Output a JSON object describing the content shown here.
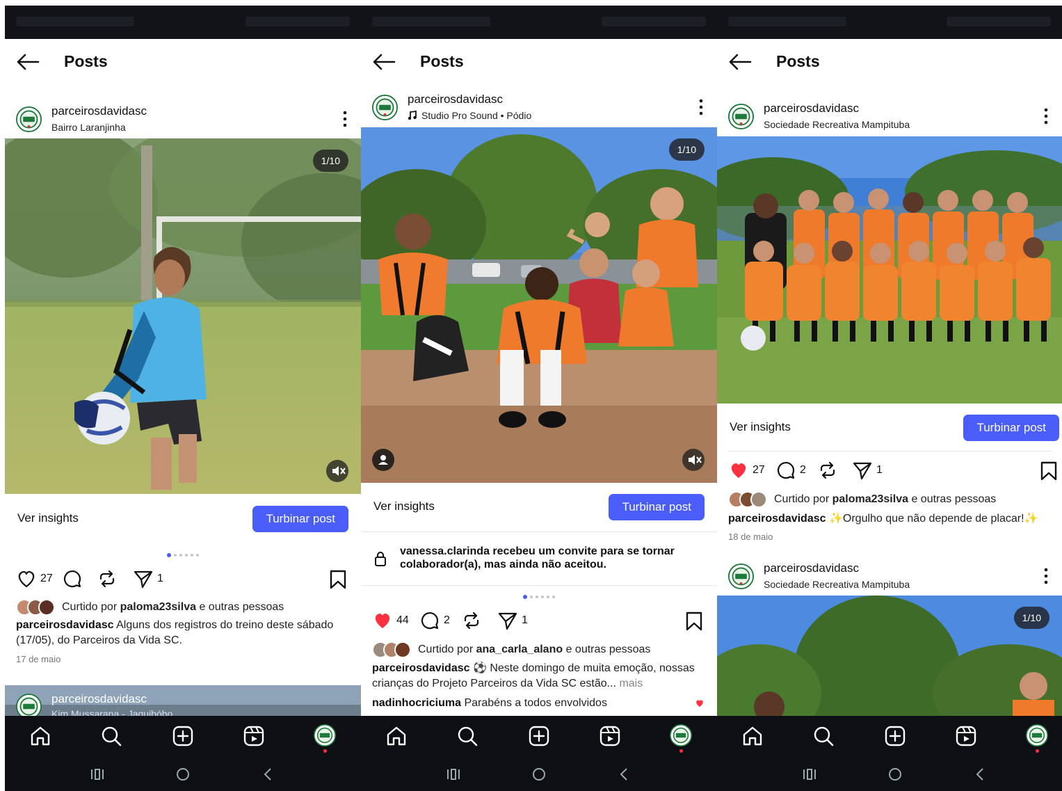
{
  "header": {
    "title": "Posts"
  },
  "panels": [
    {
      "author": {
        "name": "parceirosdavidasc",
        "subtitle": "Bairro Laranjinha"
      },
      "photo": {
        "counter": "1/10"
      },
      "insights": {
        "label": "Ver insights",
        "boost": "Turbinar post"
      },
      "actions": {
        "likes": "27",
        "shares": "1"
      },
      "liked_by": {
        "prefix": "Curtido por ",
        "user": "paloma23silva",
        "suffix": " e outras pessoas"
      },
      "caption": {
        "user": "parceirosdavidasc",
        "text": " Alguns dos registros do treino deste sábado (17/05), do Parceiros da Vida SC."
      },
      "date": "17 de maio",
      "next_post": {
        "name": "parceirosdavidasc",
        "subtitle": "Kim Mussarana - Jaquibóbo"
      }
    },
    {
      "author": {
        "name": "parceirosdavidasc",
        "subtitle": "Studio Pro Sound • Pódio"
      },
      "photo": {
        "counter": "1/10"
      },
      "insights": {
        "label": "Ver insights",
        "boost": "Turbinar post"
      },
      "notice": "vanessa.clarinda recebeu um convite para se tornar colaborador(a), mas ainda não aceitou.",
      "actions": {
        "likes": "44",
        "comments": "2",
        "shares": "1"
      },
      "liked_by": {
        "prefix": "Curtido por ",
        "user": "ana_carla_alano",
        "suffix": " e outras pessoas"
      },
      "caption": {
        "user": "parceirosdavidasc",
        "text": " ⚽ Neste domingo de muita emoção, nossas crianças do Projeto Parceiros da Vida SC estão...",
        "more": " mais"
      },
      "comment": {
        "user": "nadinhocriciuma",
        "text": " Parabéns a todos envolvidos"
      }
    },
    {
      "author": {
        "name": "parceirosdavidasc",
        "subtitle": "Sociedade Recreativa Mampituba"
      },
      "insights": {
        "label": "Ver insights",
        "boost": "Turbinar post"
      },
      "actions": {
        "likes": "27",
        "comments": "2",
        "shares": "1"
      },
      "liked_by": {
        "prefix": "Curtido por ",
        "user": "paloma23silva",
        "suffix": " e outras pessoas"
      },
      "caption": {
        "user": "parceirosdavidasc",
        "text": " ✨Orgulho que não depende de placar!✨"
      },
      "date": "18 de maio",
      "next_post": {
        "name": "parceirosdavidasc",
        "subtitle": "Sociedade Recreativa Mampituba",
        "counter": "1/10"
      }
    }
  ],
  "colors": {
    "accent": "#4a5df9",
    "like": "#ff3040",
    "nav_bg": "#0d0f14"
  },
  "icons": [
    "back-arrow-icon",
    "kebab-icon",
    "heart-icon",
    "comment-icon",
    "repost-icon",
    "send-icon",
    "bookmark-icon",
    "home-icon",
    "search-icon",
    "create-icon",
    "reels-icon",
    "lock-icon",
    "mute-icon",
    "tag-person-icon",
    "music-note-icon"
  ]
}
